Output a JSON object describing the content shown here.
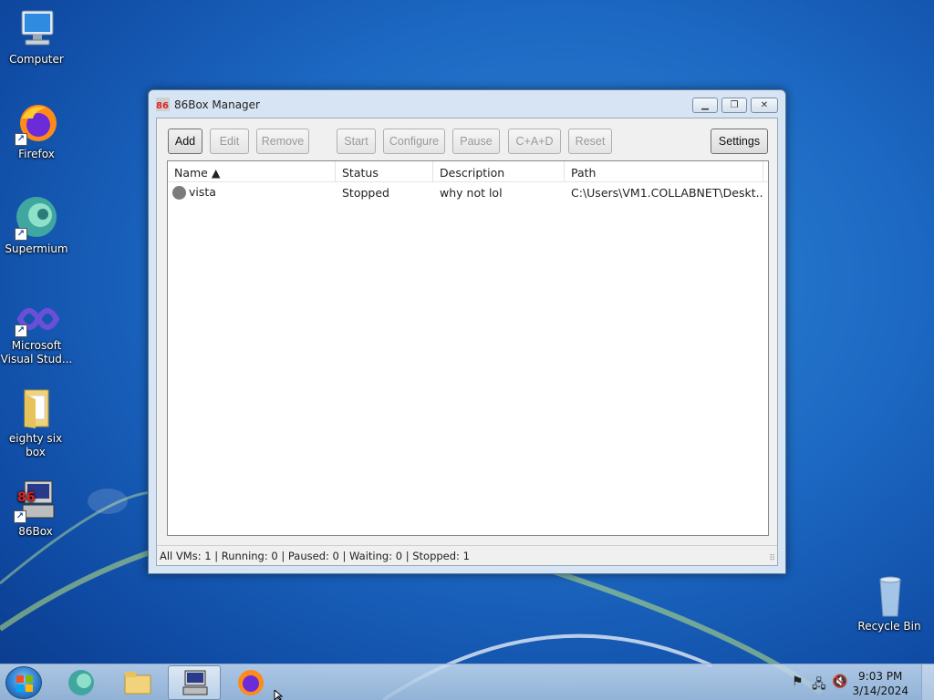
{
  "desktop": {
    "icons": [
      {
        "label": "Computer"
      },
      {
        "label": "Firefox"
      },
      {
        "label": "Supermium"
      },
      {
        "label": "Microsoft\nVisual Stud..."
      },
      {
        "label": "eighty six box"
      },
      {
        "label": "86Box"
      },
      {
        "label": "Recycle Bin"
      }
    ]
  },
  "window": {
    "title": "86Box Manager",
    "toolbar": {
      "add": "Add",
      "edit": "Edit",
      "remove": "Remove",
      "start": "Start",
      "configure": "Configure",
      "pause": "Pause",
      "cad": "C+A+D",
      "reset": "Reset",
      "settings": "Settings"
    },
    "columns": [
      "Name ▲",
      "Status",
      "Description",
      "Path"
    ],
    "rows": [
      {
        "name": "vista",
        "status": "Stopped",
        "description": "why not lol",
        "path": "C:\\Users\\VM1.COLLABNET\\Deskt..."
      }
    ],
    "statusbar": "All VMs: 1 | Running: 0 | Paused: 0 | Waiting: 0 | Stopped: 1"
  },
  "taskbar": {
    "clock_time": "9:03 PM",
    "clock_date": "3/14/2024"
  },
  "colors": {
    "desktop_bg": "#1c68c2",
    "status_stopped": "#7c7c7c"
  }
}
